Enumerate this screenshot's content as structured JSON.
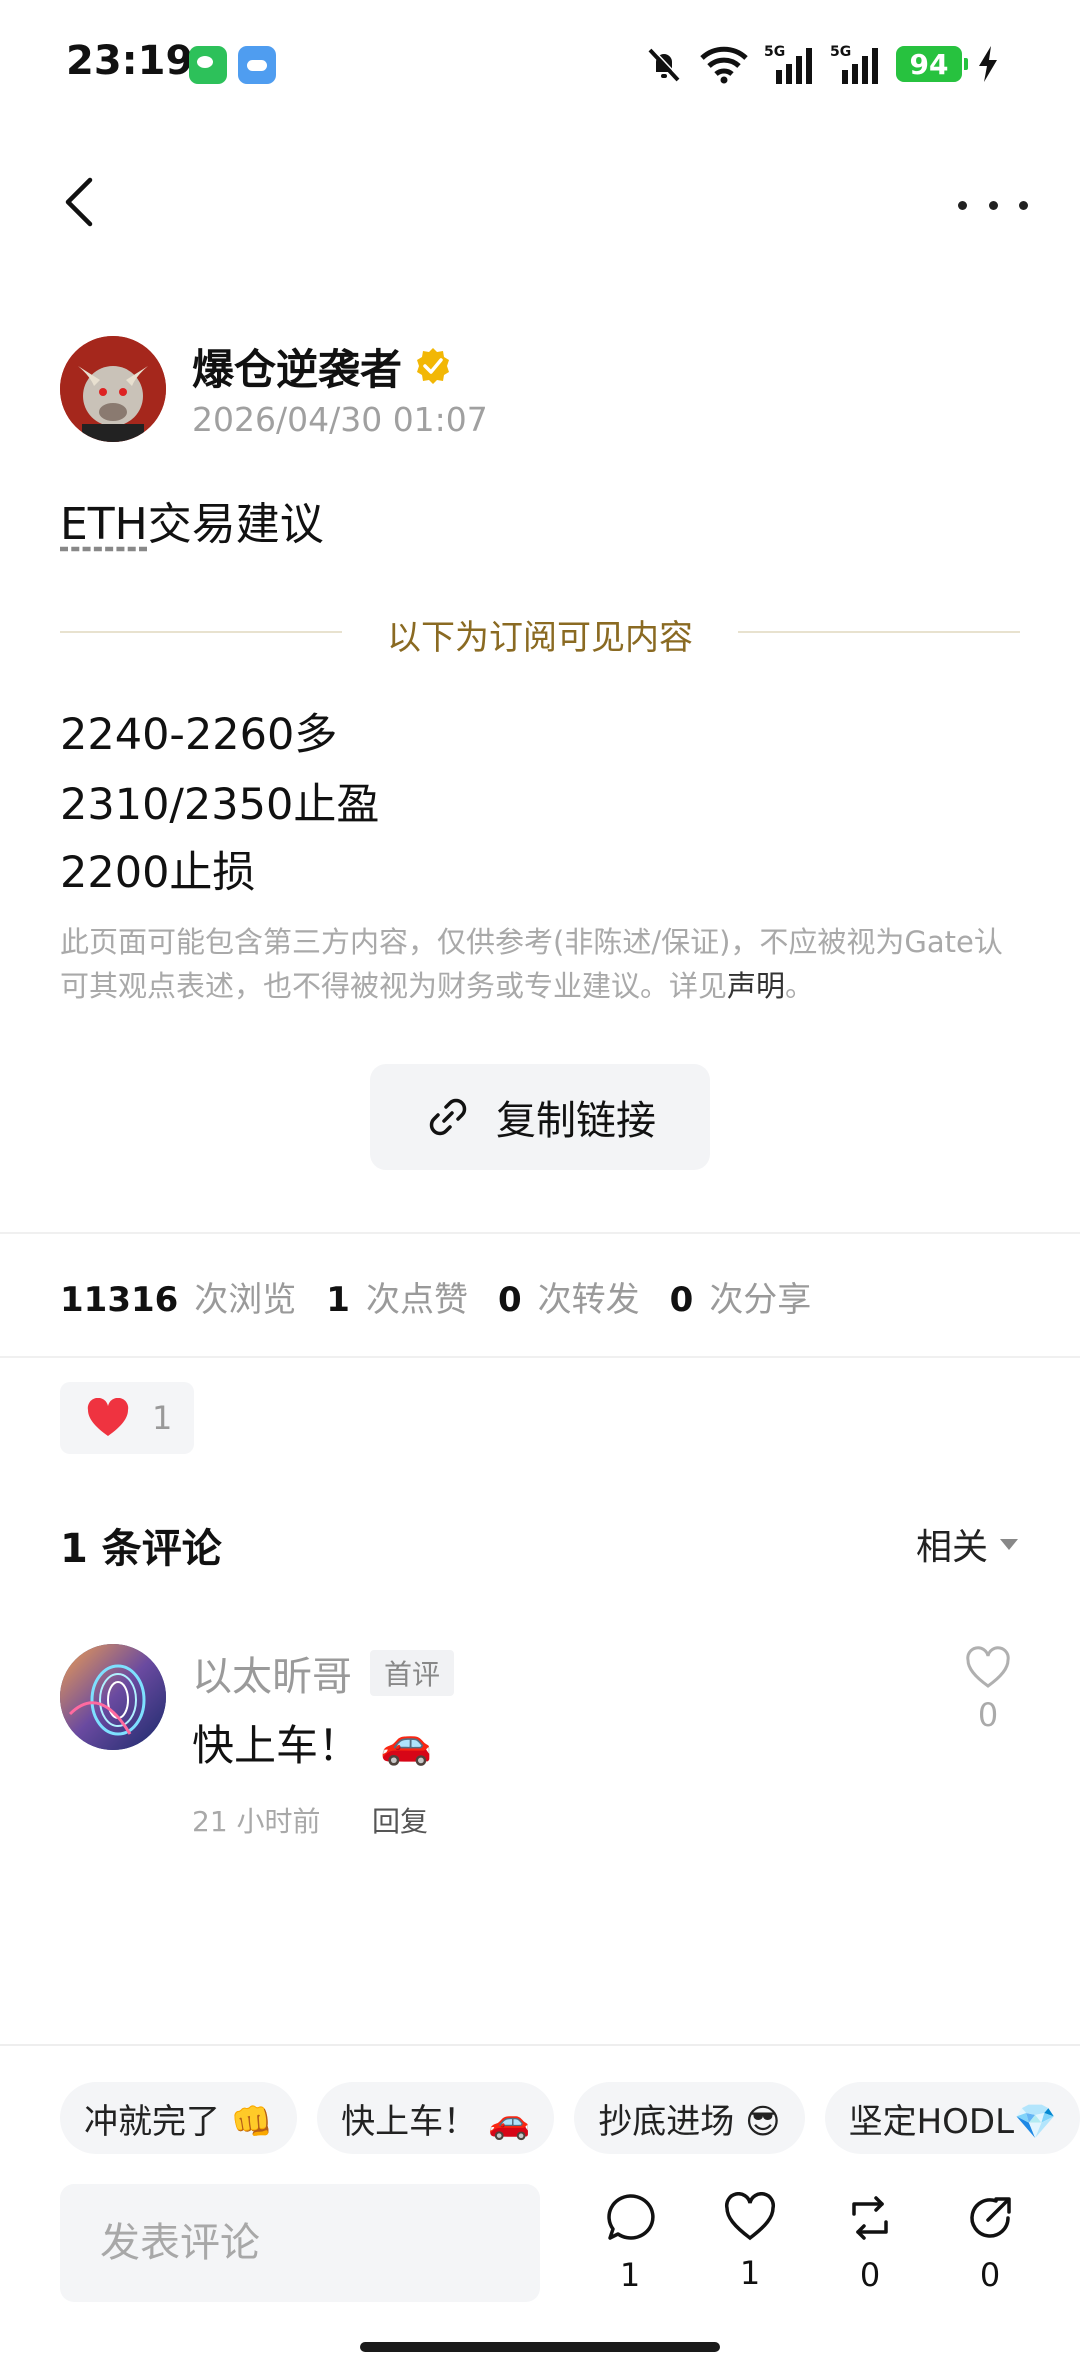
{
  "status_bar": {
    "time": "23:19",
    "battery": "94",
    "signal_1": "5G",
    "signal_2": "5G"
  },
  "post": {
    "author": "爆仓逆袭者",
    "timestamp": "2026/04/30 01:07",
    "title_ticker": "ETH",
    "title_rest": "交易建议",
    "subscription_divider": "以下为订阅可见内容",
    "lines": [
      "2240-2260多",
      "2310/2350止盈",
      "2200止损"
    ],
    "disclaimer": "此页面可能包含第三方内容，仅供参考(非陈述/保证)，不应被视为Gate认可其观点表述，也不得被视为财务或专业建议。详见",
    "disclaimer_link": "声明",
    "disclaimer_end": "。",
    "copy_link_label": "复制链接"
  },
  "stats": {
    "views": "11316",
    "views_label": "次浏览",
    "likes": "1",
    "likes_label": "次点赞",
    "reposts": "0",
    "reposts_label": "次转发",
    "shares": "0",
    "shares_label": "次分享"
  },
  "reaction": {
    "emoji": "heart-icon",
    "count": "1"
  },
  "comments": {
    "title": "1 条评论",
    "sort": "相关",
    "items": [
      {
        "author": "以太昕哥",
        "badge": "首评",
        "text": "快上车！",
        "emoji": "🚗",
        "time": "21 小时前",
        "reply": "回复",
        "likes": "0"
      }
    ]
  },
  "quick_replies": [
    "冲就完了 👊",
    "快上车！ 🚗",
    "抄底进场 😎",
    "坚定HODL💎"
  ],
  "bottom_bar": {
    "input_placeholder": "发表评论",
    "comment_count": "1",
    "like_count": "1",
    "repost_count": "0",
    "share_count": "0"
  },
  "colors": {
    "accent_gold": "#8a6a22",
    "battery_green": "#27c23f",
    "verified_gold": "#f2b705",
    "heart_red": "#ef3340"
  }
}
